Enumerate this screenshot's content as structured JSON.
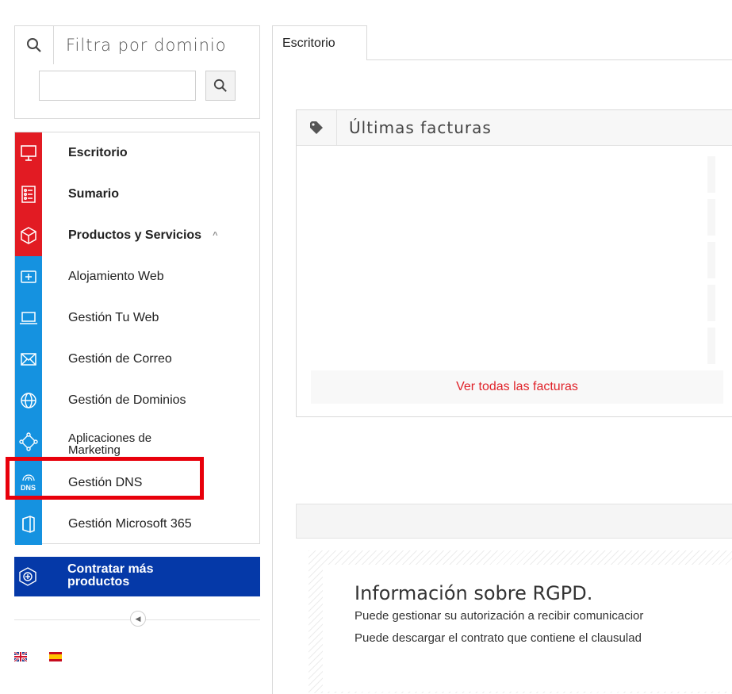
{
  "sidebar": {
    "filter_title": "Filtra por dominio",
    "search_value": "",
    "items": [
      {
        "label": "Escritorio",
        "icon": "monitor-icon",
        "style": "red",
        "bold": true
      },
      {
        "label": "Sumario",
        "icon": "list-icon",
        "style": "red",
        "bold": true
      },
      {
        "label": "Productos y Servicios",
        "icon": "cube-icon",
        "style": "red",
        "bold": true,
        "expanded": true
      },
      {
        "label": "Alojamiento Web",
        "icon": "plus-box-icon",
        "style": "blue",
        "bold": false
      },
      {
        "label": "Gestión Tu Web",
        "icon": "laptop-icon",
        "style": "blue",
        "bold": false
      },
      {
        "label": "Gestión de Correo",
        "icon": "envelope-icon",
        "style": "blue",
        "bold": false
      },
      {
        "label": "Gestión de Dominios",
        "icon": "globe-icon",
        "style": "blue",
        "bold": false
      },
      {
        "label": "Aplicaciones de Marketing",
        "icon": "network-icon",
        "style": "blue",
        "bold": false
      },
      {
        "label": "Gestión DNS",
        "icon": "dns-icon",
        "style": "blue",
        "bold": false,
        "highlighted": true
      },
      {
        "label": "Gestión Microsoft 365",
        "icon": "office-icon",
        "style": "blue",
        "bold": false
      }
    ],
    "contract_label": "Contratar más productos",
    "languages": [
      "en",
      "es"
    ]
  },
  "main": {
    "tab_label": "Escritorio",
    "invoices": {
      "title": "Últimas facturas",
      "view_all": "Ver todas las facturas"
    },
    "rgpd": {
      "title": "Información sobre RGPD.",
      "line1": "Puede gestionar su autorización a recibir comunicacior",
      "line2": "Puede descargar el contrato que contiene el clausulad"
    }
  },
  "colors": {
    "red": "#e21b23",
    "blue": "#1592e0",
    "navy": "#0539a8",
    "highlight": "#e8000b",
    "link": "#e0232a"
  }
}
